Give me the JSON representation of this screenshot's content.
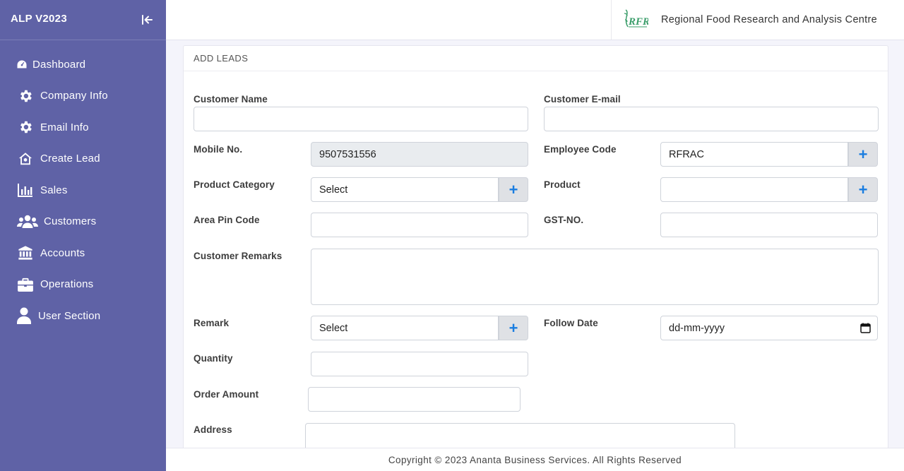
{
  "app": {
    "title": "ALP V2023"
  },
  "sidebar": {
    "items": [
      {
        "label": "Dashboard",
        "icon": "dashboard-icon"
      },
      {
        "label": "Company Info",
        "icon": "gear-icon"
      },
      {
        "label": "Email Info",
        "icon": "gear-icon"
      },
      {
        "label": "Create Lead",
        "icon": "home-icon"
      },
      {
        "label": "Sales",
        "icon": "bar-chart-icon"
      },
      {
        "label": "Customers",
        "icon": "users-icon"
      },
      {
        "label": "Accounts",
        "icon": "bank-icon"
      },
      {
        "label": "Operations",
        "icon": "briefcase-icon"
      },
      {
        "label": "User Section",
        "icon": "user-icon"
      }
    ]
  },
  "header": {
    "organization": "Regional Food Research and Analysis Centre",
    "logo_text": "RFRAC"
  },
  "form": {
    "title": "ADD LEADS",
    "customer_name": {
      "label": "Customer Name",
      "value": ""
    },
    "customer_email": {
      "label": "Customer E-mail",
      "value": ""
    },
    "mobile": {
      "label": "Mobile No.",
      "value": "9507531556"
    },
    "employee_code": {
      "label": "Employee Code",
      "value": "RFRAC"
    },
    "product_category": {
      "label": "Product Category",
      "value": "Select"
    },
    "product": {
      "label": "Product",
      "value": ""
    },
    "area_pin": {
      "label": "Area Pin Code",
      "value": ""
    },
    "gst": {
      "label": "GST-NO.",
      "value": ""
    },
    "remarks": {
      "label": "Customer Remarks",
      "value": ""
    },
    "remark": {
      "label": "Remark",
      "value": "Select"
    },
    "follow_date": {
      "label": "Follow Date",
      "value": "dd-mm-yyyy"
    },
    "quantity": {
      "label": "Quantity",
      "value": ""
    },
    "order_amount": {
      "label": "Order Amount",
      "value": ""
    },
    "address": {
      "label": "Address",
      "value": ""
    }
  },
  "footer": {
    "text": "Copyright © 2023 Ananta Business Services. All Rights Reserved"
  },
  "colors": {
    "sidebar": "#5f62a6",
    "accent": "#1a7de0",
    "readonly": "#e9ecef"
  }
}
